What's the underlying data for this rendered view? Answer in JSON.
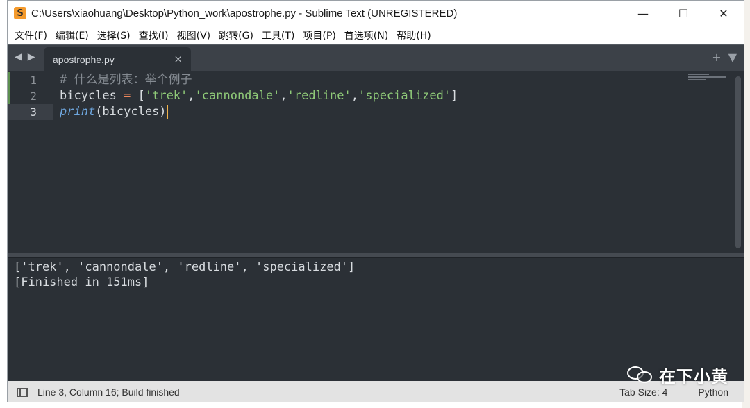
{
  "window": {
    "title": "C:\\Users\\xiaohuang\\Desktop\\Python_work\\apostrophe.py - Sublime Text (UNREGISTERED)",
    "app_icon": "sublime-text-icon",
    "controls": {
      "minimize": "—",
      "maximize": "☐",
      "close": "✕"
    }
  },
  "menu": {
    "items": [
      "文件(F)",
      "编辑(E)",
      "选择(S)",
      "查找(I)",
      "视图(V)",
      "跳转(G)",
      "工具(T)",
      "项目(P)",
      "首选项(N)",
      "帮助(H)"
    ]
  },
  "tabs": {
    "nav_prev": "◀",
    "nav_next": "▶",
    "active_label": "apostrophe.py",
    "close": "×",
    "new_tab": "+",
    "tab_menu": "▼"
  },
  "editor": {
    "line_numbers": [
      "1",
      "2",
      "3"
    ],
    "active_line": 3,
    "lines": {
      "l1_comment": "# 什么是列表：举个例子",
      "l2_var": "bicycles ",
      "l2_eq": "=",
      "l2_open": " [",
      "l2_s1": "'trek'",
      "l2_c1": ",",
      "l2_s2": "'cannondale'",
      "l2_c2": ",",
      "l2_s3": "'redline'",
      "l2_c3": ",",
      "l2_s4": "'specialized'",
      "l2_close": "]",
      "l3_fn": "print",
      "l3_args": "(bicycles)"
    }
  },
  "output": {
    "lines": [
      "['trek', 'cannondale', 'redline', 'specialized']",
      "[Finished in 151ms]"
    ]
  },
  "status": {
    "left": "Line 3, Column 16; Build finished",
    "tab_size": "Tab Size: 4",
    "syntax": "Python"
  },
  "watermark": {
    "icon": "wechat-icon",
    "text": "在下小黄"
  }
}
